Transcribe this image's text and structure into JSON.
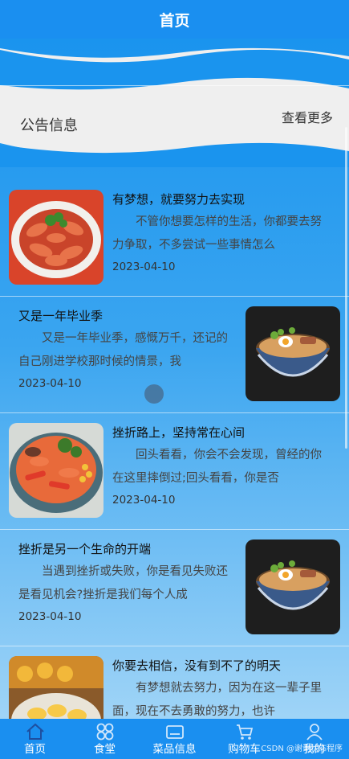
{
  "header": {
    "title": "首页"
  },
  "notice": {
    "title": "公告信息",
    "more": "查看更多"
  },
  "news": [
    {
      "title": "有梦想，就要努力去实现",
      "desc": "不管你想要怎样的生活，你都要去努力争取，不多尝试一些事情怎么",
      "date": "2023-04-10",
      "image": "shrimp-dish-photo",
      "image_side": "left"
    },
    {
      "title": "又是一年毕业季",
      "desc": "又是一年毕业季，感慨万千，还记的自己刚进学校那时候的情景，我",
      "date": "2023-04-10",
      "image": "ramen-bowl-photo",
      "image_side": "right"
    },
    {
      "title": "挫折路上，坚持常在心间",
      "desc": "回头看看，你会不会发现，曾经的你在这里摔倒过;回头看看，你是否",
      "date": "2023-04-10",
      "image": "seafood-bowl-photo",
      "image_side": "left"
    },
    {
      "title": "挫折是另一个生命的开端",
      "desc": "当遇到挫折或失败，你是看见失败还是看见机会?挫折是我们每个人成",
      "date": "2023-04-10",
      "image": "ramen-bowl-photo",
      "image_side": "right"
    },
    {
      "title": "你要去相信，没有到不了的明天",
      "desc": "有梦想就去努力，因为在这一辈子里面，现在不去勇敢的努力，也许",
      "date": "",
      "image": "pineapple-dish-photo",
      "image_side": "left"
    }
  ],
  "tabbar": [
    {
      "label": "首页",
      "icon": "home-icon"
    },
    {
      "label": "食堂",
      "icon": "grid-icon"
    },
    {
      "label": "菜品信息",
      "icon": "menu-card-icon"
    },
    {
      "label": "购物车",
      "icon": "cart-icon"
    },
    {
      "label": "我的",
      "icon": "user-icon"
    }
  ],
  "watermark": "CSDN @谢谢状态程序",
  "colors": {
    "primary": "#1a8ff0",
    "background_top": "#1a94ee",
    "background_bottom": "#9fd4f7"
  }
}
